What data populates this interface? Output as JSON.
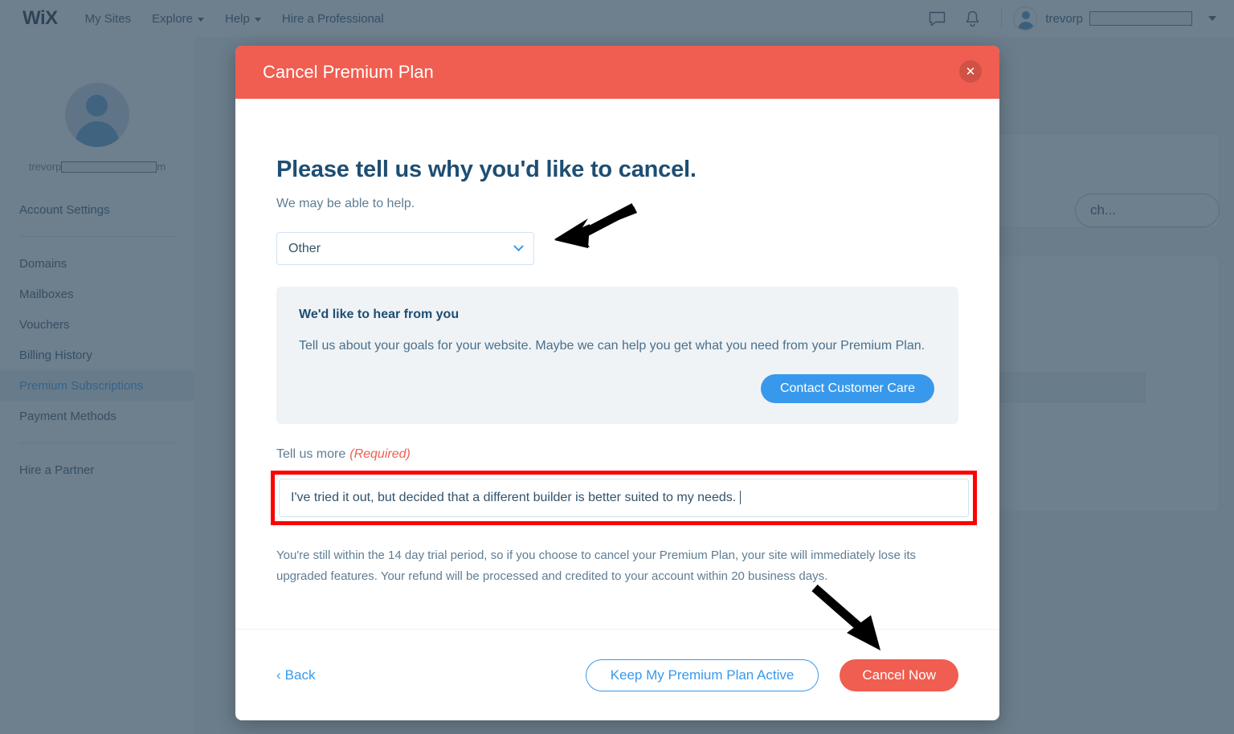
{
  "topbar": {
    "logo": "WiX",
    "nav": [
      {
        "label": "My Sites",
        "has_caret": false
      },
      {
        "label": "Explore",
        "has_caret": true
      },
      {
        "label": "Help",
        "has_caret": true
      },
      {
        "label": "Hire a Professional",
        "has_caret": false
      }
    ],
    "chat_icon": "chat-bubble-icon",
    "bell_icon": "notification-bell-icon",
    "username": "trevorp",
    "username_redacted": true
  },
  "sidebar": {
    "avatar": "user-avatar",
    "email_prefix": "trevorp",
    "email_suffix": "m",
    "items": [
      {
        "label": "Account Settings",
        "active": false
      },
      {
        "label": "Domains",
        "active": false
      },
      {
        "label": "Mailboxes",
        "active": false
      },
      {
        "label": "Vouchers",
        "active": false
      },
      {
        "label": "Billing History",
        "active": false
      },
      {
        "label": "Premium Subscriptions",
        "active": true
      },
      {
        "label": "Payment Methods",
        "active": false
      },
      {
        "label": "Hire a Partner",
        "active": false
      }
    ]
  },
  "background": {
    "search_text": "ch...",
    "more_dots": "•••"
  },
  "modal": {
    "title": "Cancel Premium Plan",
    "close_icon": "close-x-icon",
    "heading": "Please tell us why you'd like to cancel.",
    "subheading": "We may be able to help.",
    "reason_select": {
      "value": "Other",
      "chevron_icon": "chevron-down-icon"
    },
    "info_box": {
      "title": "We'd like to hear from you",
      "text": "Tell us about your goals for your website. Maybe we can help you get what you need from your Premium Plan.",
      "button_label": "Contact Customer Care"
    },
    "tell_us_more": {
      "label": "Tell us more",
      "required_tag": "(Required)",
      "value": "I've tried it out, but decided that a different builder is better suited to my needs.",
      "placeholder": ""
    },
    "disclaimer": "You're still within the 14 day trial period, so if you choose to cancel your Premium Plan, your site will immediately lose its upgraded features. Your refund will be processed and credited to your account within 20 business days.",
    "footer": {
      "back_label": "Back",
      "back_icon": "chevron-left-icon",
      "keep_label": "Keep My Premium Plan Active",
      "cancel_label": "Cancel Now"
    }
  },
  "annotations": {
    "arrow_to_dropdown": "arrow-pointing-to-reason-dropdown",
    "arrow_to_cancel": "arrow-pointing-to-cancel-now-button",
    "highlight_color": "#ff0000"
  },
  "colors": {
    "brand_red": "#ef5e50",
    "brand_blue": "#3899ec",
    "heading_blue": "#1e4e73",
    "text_slate": "#5f7d92",
    "overlay": "#364e61",
    "highlight": "#ff0000"
  }
}
